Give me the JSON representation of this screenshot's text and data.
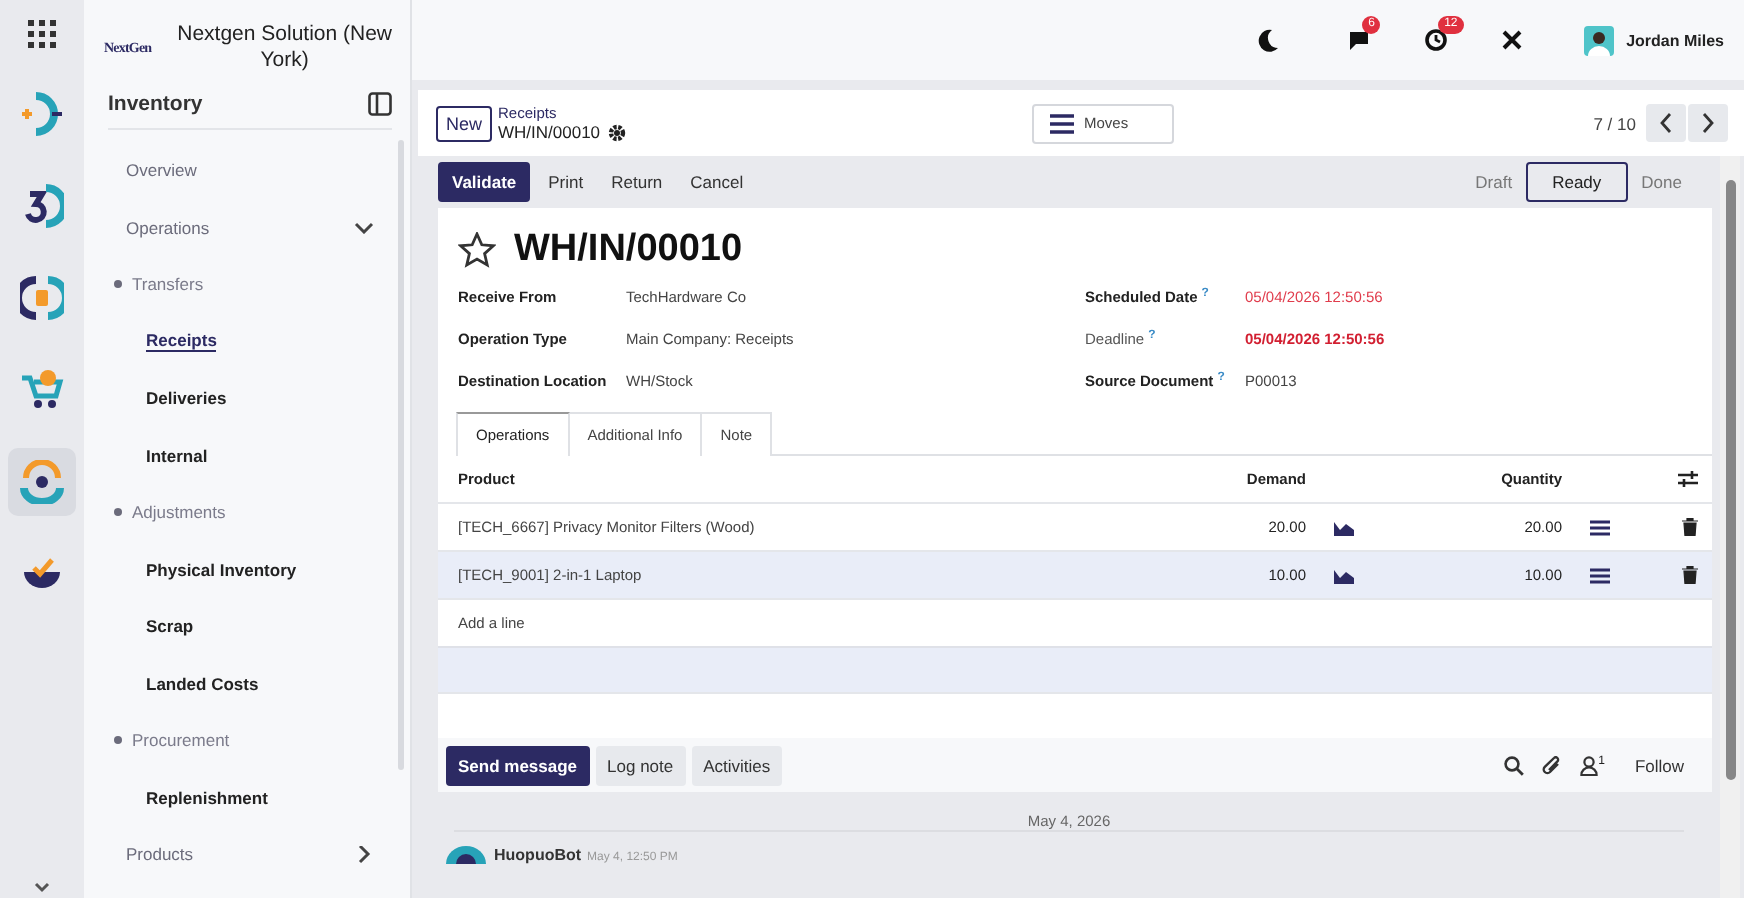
{
  "app_rail": {
    "apps": [
      {
        "selected": false
      },
      {
        "selected": false
      },
      {
        "selected": false
      },
      {
        "selected": false
      },
      {
        "selected": true
      },
      {
        "selected": false
      }
    ]
  },
  "company": {
    "logo_text": "NextGen",
    "name": "Nextgen Solution (New York)"
  },
  "sidebar": {
    "title": "Inventory",
    "items": [
      {
        "kind": "link",
        "label": "Overview",
        "selected": false
      },
      {
        "kind": "section",
        "label": "Operations",
        "expanded": true
      },
      {
        "kind": "group",
        "label": "Transfers"
      },
      {
        "kind": "item",
        "label": "Receipts",
        "selected": true
      },
      {
        "kind": "item",
        "label": "Deliveries",
        "selected": false
      },
      {
        "kind": "item",
        "label": "Internal",
        "selected": false
      },
      {
        "kind": "group",
        "label": "Adjustments"
      },
      {
        "kind": "item",
        "label": "Physical Inventory",
        "selected": false
      },
      {
        "kind": "item",
        "label": "Scrap",
        "selected": false
      },
      {
        "kind": "item",
        "label": "Landed Costs",
        "selected": false
      },
      {
        "kind": "group",
        "label": "Procurement"
      },
      {
        "kind": "item",
        "label": "Replenishment",
        "selected": false
      },
      {
        "kind": "section",
        "label": "Products",
        "expanded": false
      }
    ]
  },
  "topbar": {
    "messages_badge": "6",
    "activities_badge": "12",
    "user": "Jordan Miles"
  },
  "control_panel": {
    "new_button": "New",
    "breadcrumb": "Receipts",
    "record": "WH/IN/00010",
    "moves_button": "Moves",
    "pager": "7 / 10"
  },
  "actions": [
    {
      "label": "Validate",
      "kind": "primary"
    },
    {
      "label": "Print",
      "kind": "plain"
    },
    {
      "label": "Return",
      "kind": "plain"
    },
    {
      "label": "Cancel",
      "kind": "plain"
    }
  ],
  "status_steps": [
    {
      "label": "Draft",
      "selected": false
    },
    {
      "label": "Ready",
      "selected": true
    },
    {
      "label": "Done",
      "selected": false
    }
  ],
  "form": {
    "title": "WH/IN/00010",
    "starred": false,
    "left_fields": [
      {
        "label": "Receive From",
        "value": "TechHardware Co"
      },
      {
        "label": "Operation Type",
        "value": "Main Company: Receipts"
      },
      {
        "label": "Destination Location",
        "value": "WH/Stock"
      }
    ],
    "right_fields": [
      {
        "label": "Scheduled Date",
        "help": "?",
        "value": "05/04/2026 12:50:56",
        "kind": "late",
        "label_muted": false
      },
      {
        "label": "Deadline",
        "help": "?",
        "value": "05/04/2026 12:50:56",
        "kind": "late-strong",
        "label_muted": true
      },
      {
        "label": "Source Document",
        "help": "?",
        "value": "P00013",
        "kind": "plain",
        "label_muted": false
      }
    ]
  },
  "tabs": [
    {
      "label": "Operations",
      "selected": true
    },
    {
      "label": "Additional Info",
      "selected": false
    },
    {
      "label": "Note",
      "selected": false
    }
  ],
  "table": {
    "columns": [
      "Product",
      "Demand",
      "Quantity"
    ],
    "rows": [
      {
        "product": "[TECH_6667] Privacy Monitor Filters (Wood)",
        "demand": "20.00",
        "quantity": "20.00",
        "selected": false
      },
      {
        "product": "[TECH_9001] 2-in-1 Laptop",
        "demand": "10.00",
        "quantity": "10.00",
        "selected": true
      }
    ],
    "add_line": "Add a line"
  },
  "chatter": {
    "buttons": [
      {
        "label": "Send message",
        "selected": true
      },
      {
        "label": "Log note",
        "selected": false
      },
      {
        "label": "Activities",
        "selected": false
      }
    ],
    "followers": "1",
    "follow": "Follow",
    "date": "May 4, 2026",
    "message": {
      "author": "HuopuoBot",
      "time": "May 4, 12:50 PM"
    }
  }
}
